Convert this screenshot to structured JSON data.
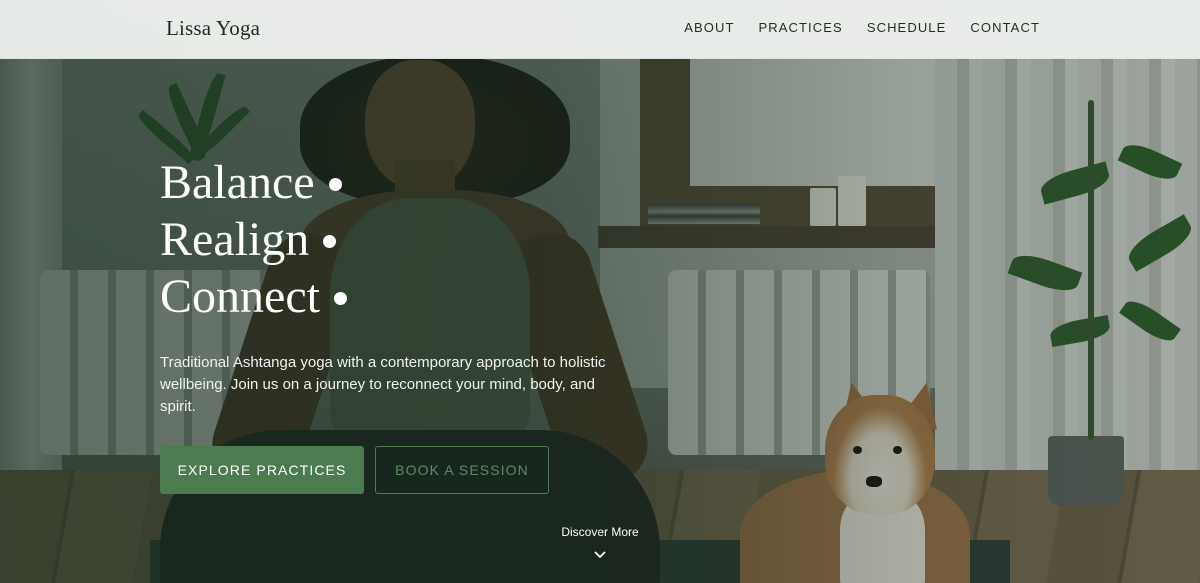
{
  "brand": {
    "name": "Lissa Yoga"
  },
  "nav": {
    "items": [
      {
        "label": "ABOUT"
      },
      {
        "label": "PRACTICES"
      },
      {
        "label": "SCHEDULE"
      },
      {
        "label": "CONTACT"
      }
    ]
  },
  "hero": {
    "headline_lines": [
      "Balance",
      "Realign",
      "Connect"
    ],
    "description": "Traditional Ashtanga yoga with a contemporary approach to holistic wellbeing. Join us on a journey to reconnect your mind, body, and spirit.",
    "primary_button": "EXPLORE PRACTICES",
    "secondary_button": "BOOK A SESSION",
    "scroll_hint": "Discover More",
    "scroll_icon": "chevron-down-icon",
    "photo": "woman-meditating-with-dog-photo"
  },
  "colors": {
    "header_bg": "#eef1ee",
    "accent_green": "#4d7b50",
    "overlay": "#162c1e",
    "text_light": "#ffffff",
    "text_dark": "#1c2b20"
  }
}
